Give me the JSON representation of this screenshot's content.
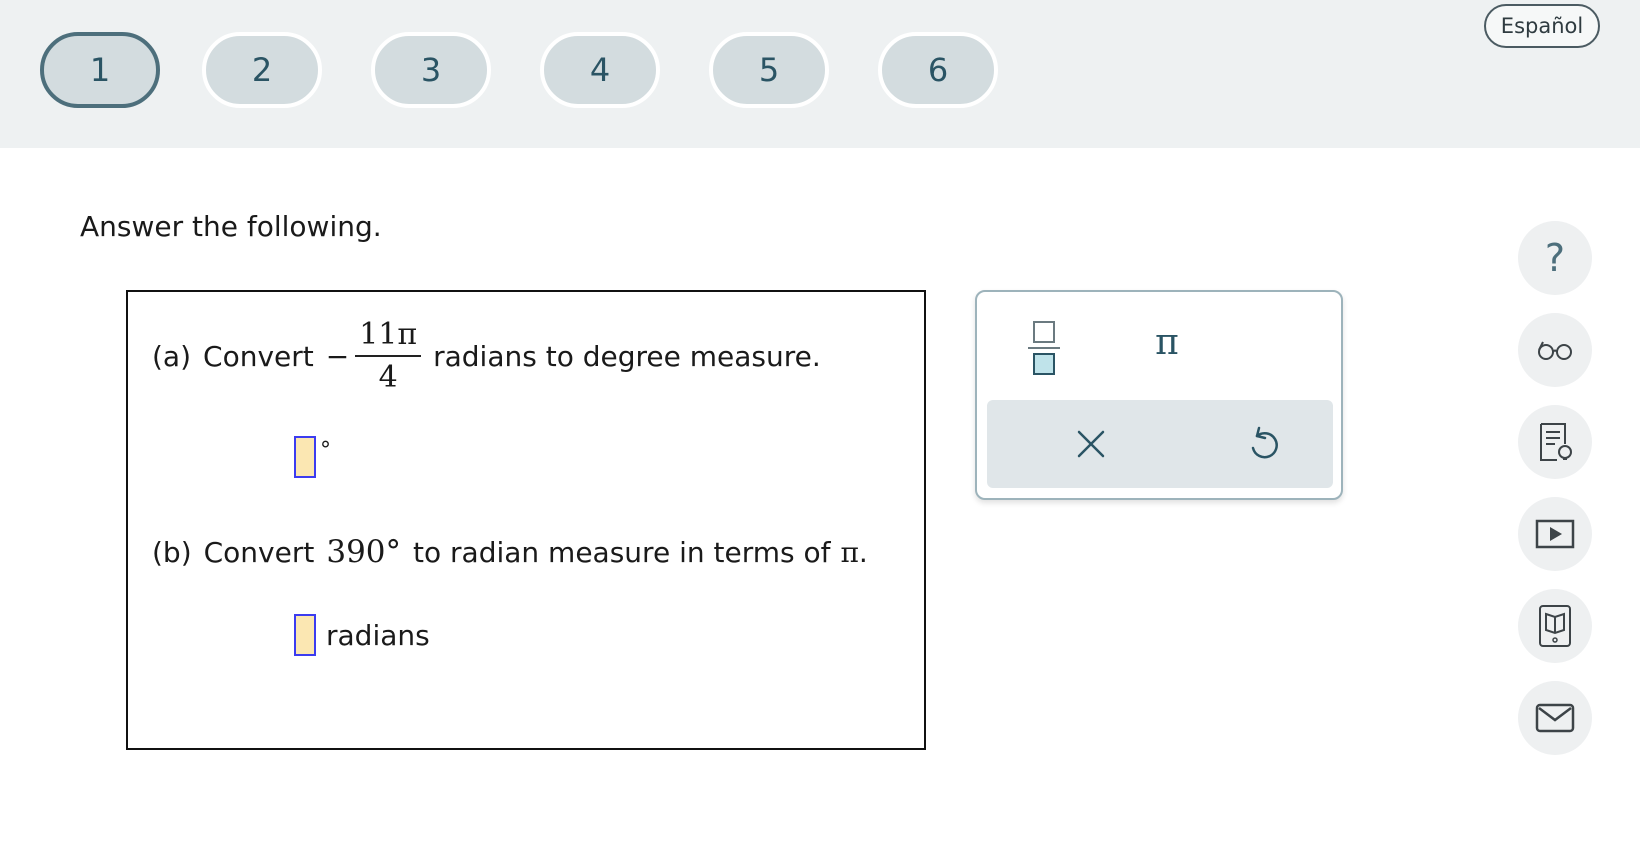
{
  "nav": {
    "questions": [
      "1",
      "2",
      "3",
      "4",
      "5",
      "6"
    ],
    "active": "1",
    "language_label": "Español"
  },
  "instructions": "Answer the following.",
  "problem": {
    "part_a": {
      "label": "(a)",
      "prefix": "Convert",
      "minus": "−",
      "numerator": "11π",
      "denominator": "4",
      "suffix": "radians to degree measure.",
      "answer_value": "",
      "answer_unit": "°"
    },
    "part_b": {
      "label": "(b)",
      "prefix": "Convert",
      "value": "390°",
      "suffix_text": "to radian measure in terms of",
      "pi": "π",
      "period": ".",
      "answer_value": "",
      "answer_unit": "radians"
    }
  },
  "palette": {
    "fraction_icon": "fraction-icon",
    "pi_label": "π",
    "clear_icon": "close-icon",
    "undo_icon": "undo-icon"
  },
  "tools": [
    "help-icon",
    "glasses-icon",
    "hint-document-icon",
    "video-icon",
    "textbook-icon",
    "mail-icon"
  ],
  "colors": {
    "accent": "#2a5464",
    "topbar_bg": "#eef1f2",
    "nav_pill": "#d3dcdf",
    "answer_box_fill": "#fbe7b2",
    "answer_box_border": "#3c3cf0"
  }
}
